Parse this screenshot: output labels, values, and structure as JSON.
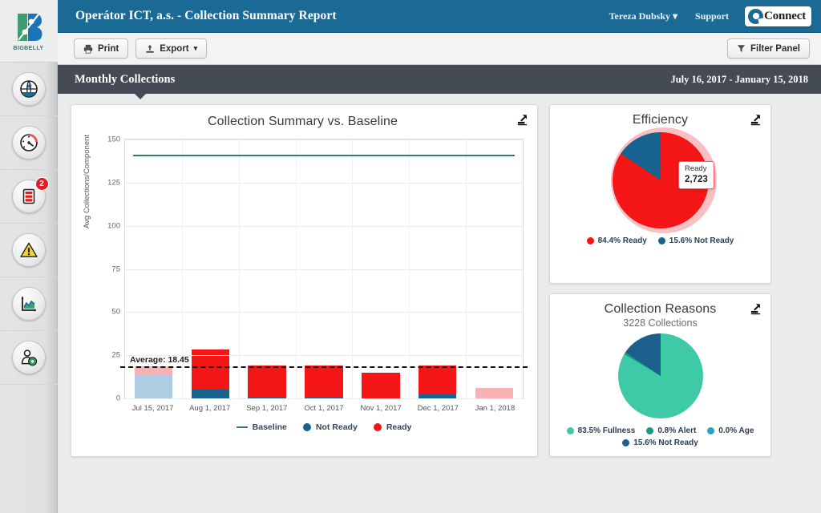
{
  "sidebar": {
    "logo": {
      "name": "bigbelly-logo",
      "text": "BIGBELLY"
    },
    "items": [
      {
        "icon": "globe-icon",
        "label": "Map"
      },
      {
        "icon": "gauge-icon",
        "label": "Dashboard"
      },
      {
        "icon": "bins-icon",
        "label": "Assets",
        "badge": "2"
      },
      {
        "icon": "warning-triangle-icon",
        "label": "Alerts"
      },
      {
        "icon": "chart-icon",
        "label": "Reports"
      },
      {
        "icon": "user-settings-icon",
        "label": "Administration"
      }
    ]
  },
  "topbar": {
    "title": "Operátor ICT, a.s. - Collection Summary Report",
    "user": "Tereza Dubsky",
    "user_caret": "▾",
    "support": "Support",
    "connect_logo": "Connect"
  },
  "toolbar": {
    "print_label": "Print",
    "export_label": "Export",
    "export_caret": "▾",
    "filter_label": "Filter Panel"
  },
  "section": {
    "title": "Monthly Collections",
    "date_range": "July 16, 2017 - January 15, 2018"
  },
  "colors": {
    "ready": "#f41616",
    "not_ready": "#15638e",
    "ready_faded": "#f8b2b6",
    "not_ready_faded": "#aecde2",
    "baseline": "#2d8079",
    "fullness": "#3ec9a7",
    "alert": "#179b85",
    "age": "#2aa0c4",
    "brand_blue": "#1b6a96",
    "section_gray": "#444b54"
  },
  "chart_data": [
    {
      "id": "collection-summary",
      "type": "bar",
      "title": "Collection Summary vs. Baseline",
      "xlabel": "",
      "ylabel": "Avg Collections/Component",
      "ylim": [
        0,
        150
      ],
      "yticks": [
        0,
        25,
        50,
        75,
        100,
        125,
        150
      ],
      "grid": true,
      "categories": [
        "Jul 15, 2017",
        "Aug 1, 2017",
        "Sep 1, 2017",
        "Oct 1, 2017",
        "Nov 1, 2017",
        "Dec 1, 2017",
        "Jan 1, 2018"
      ],
      "series": [
        {
          "name": "Not Ready",
          "values": [
            14.0,
            5.0,
            0.6,
            0.6,
            0.0,
            2.2,
            0.0
          ]
        },
        {
          "name": "Ready",
          "values": [
            4.6,
            23.0,
            18.4,
            18.4,
            14.8,
            16.8,
            6.0
          ]
        }
      ],
      "partial_periods": [
        "Jul 15, 2017",
        "Jan 1, 2018"
      ],
      "baseline": {
        "label": "Baseline",
        "value": 141
      },
      "average": {
        "label": "Average: 18.45",
        "value": 18.45
      },
      "legend": [
        {
          "label": "Baseline",
          "marker": "line",
          "color": "#2d8079"
        },
        {
          "label": "Not Ready",
          "marker": "dot",
          "color": "#15638e"
        },
        {
          "label": "Ready",
          "marker": "dot",
          "color": "#f41616"
        }
      ],
      "legend_position": "bottom"
    },
    {
      "id": "efficiency",
      "type": "pie",
      "title": "Efficiency",
      "labels": [
        "Ready",
        "Not Ready"
      ],
      "values": [
        84.4,
        15.6
      ],
      "colors": [
        "#f41616",
        "#15638e"
      ],
      "legend": [
        "84.4% Ready",
        "15.6% Not Ready"
      ],
      "legend_position": "bottom",
      "tooltip": {
        "label": "Ready",
        "value": "2,723"
      },
      "highlight_slice": "Ready"
    },
    {
      "id": "collection-reasons",
      "type": "pie",
      "title": "Collection Reasons",
      "subtitle": "3228 Collections",
      "labels": [
        "Fullness",
        "Alert",
        "Age",
        "Not Ready"
      ],
      "values": [
        83.5,
        0.8,
        0.0,
        15.6
      ],
      "colors": [
        "#3ec9a7",
        "#179b85",
        "#2aa0c4",
        "#1b5f8c"
      ],
      "legend": [
        "83.5% Fullness",
        "0.8% Alert",
        "0.0% Age",
        "15.6% Not Ready"
      ],
      "legend_position": "bottom"
    }
  ],
  "icons": {
    "expand": "expand-icon"
  }
}
